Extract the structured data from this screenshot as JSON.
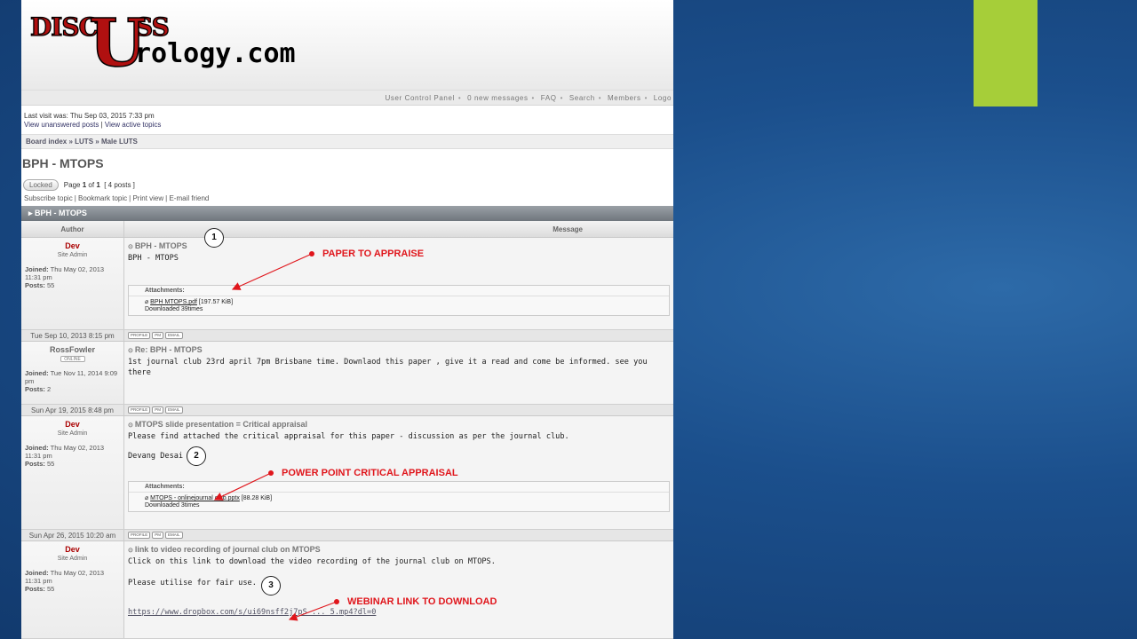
{
  "logo_text": [
    "DiscUss",
    "Urology.com"
  ],
  "nav": {
    "items": [
      "User Control Panel",
      "0 new messages",
      "FAQ",
      "Search",
      "Members",
      "Logo"
    ]
  },
  "lastvisit": {
    "text": "Last visit was: Thu Sep 03, 2015 7:33 pm",
    "link1": "View unanswered posts",
    "link2": "View active topics"
  },
  "breadcrumb": [
    "Board index",
    "LUTS",
    "Male LUTS"
  ],
  "topic": {
    "title": "BPH - MTOPS",
    "locked_label": "Locked",
    "page_text_prefix": "Page",
    "page_current": "1",
    "page_of": "of",
    "page_total": "1",
    "posts_text": "[ 4 posts ]",
    "tools": [
      "Subscribe topic",
      "Bookmark topic",
      "Print view",
      "E-mail friend"
    ],
    "bar_label": "BPH - MTOPS"
  },
  "columns": {
    "author": "Author",
    "message": "Message"
  },
  "posts": [
    {
      "author": "Dev",
      "rank": "Site Admin",
      "joined_label": "Joined:",
      "joined": "Thu May 02, 2013 11:31 pm",
      "posts_label": "Posts:",
      "posts": "55",
      "subject": "BPH - MTOPS",
      "text": "BPH - MTOPS",
      "attach_header": "Attachments:",
      "attach_file": "BPH MTOPS.pdf",
      "attach_size": "[197.57 KiB]",
      "attach_downloads": "Downloaded 39times",
      "date": "Tue Sep 10, 2013 8:15 pm"
    },
    {
      "author": "RossFowler",
      "online": "ONLINE",
      "joined_label": "Joined:",
      "joined": "Tue Nov 11, 2014 9:09 pm",
      "posts_label": "Posts:",
      "posts": "2",
      "subject": "Re: BPH - MTOPS",
      "text": "1st journal club 23rd april 7pm Brisbane time. Downlaod this paper , give it a read and come be informed. see you there",
      "date": "Sun Apr 19, 2015 8:48 pm"
    },
    {
      "author": "Dev",
      "rank": "Site Admin",
      "joined_label": "Joined:",
      "joined": "Thu May 02, 2013 11:31 pm",
      "posts_label": "Posts:",
      "posts": "55",
      "subject": "MTOPS slide presentation = Critical appraisal",
      "text": "Please find attached the critical appraisal for this paper - discussion as per the journal club.",
      "text2": "Devang Desai",
      "attach_header": "Attachments:",
      "attach_file": "MTOPS - onlinejournal club.pptx",
      "attach_size": "[88.28 KiB]",
      "attach_downloads": "Downloaded 3times",
      "date": "Sun Apr 26, 2015 10:20 am"
    },
    {
      "author": "Dev",
      "rank": "Site Admin",
      "joined_label": "Joined:",
      "joined": "Thu May 02, 2013 11:31 pm",
      "posts_label": "Posts:",
      "posts": "55",
      "subject": "link to video recording of journal club on MTOPS",
      "text": "Click on this link to download the video recording of the journal club on MTOPS.",
      "text2": "Please utilise for fair use.",
      "link": "https://www.dropbox.com/s/ui69nsff2j7pS ... 5.mp4?dl=0"
    }
  ],
  "post_buttons": [
    "PROFILE",
    "PM",
    "EMAIL"
  ],
  "annotations": {
    "a1": "PAPER TO APPRAISE",
    "a2": "POWER POINT CRITICAL APPRAISAL",
    "a3": "WEBINAR LINK TO DOWNLOAD",
    "n1": "1",
    "n2": "2",
    "n3": "3",
    "color": "#e0161c"
  },
  "colors": {
    "accent": "#a6ce39",
    "background": "#1b4f8c"
  }
}
